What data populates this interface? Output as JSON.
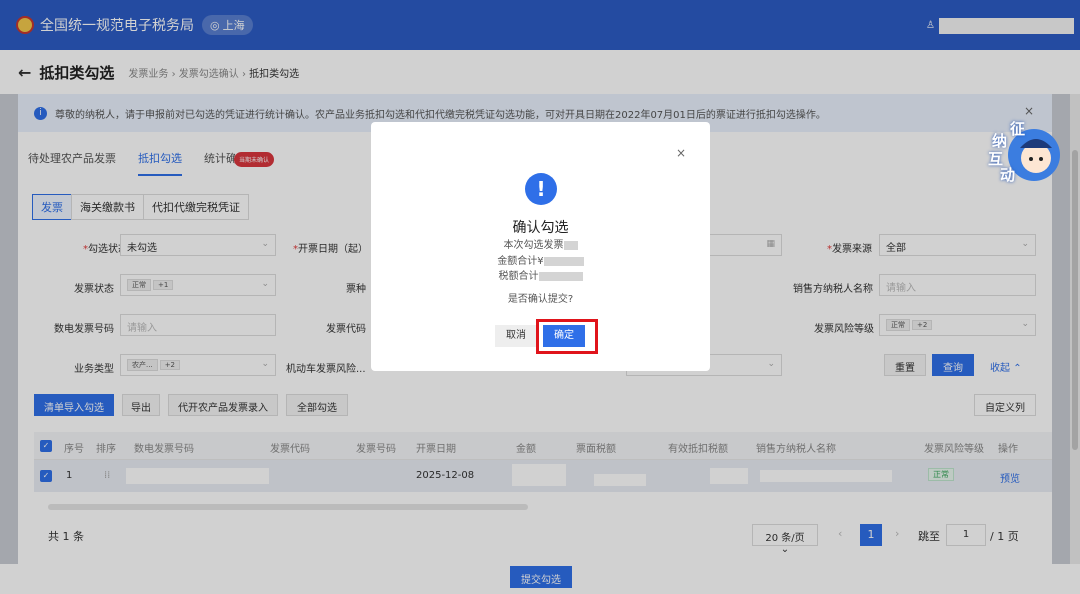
{
  "topbar": {
    "app_title": "全国统一规范电子税务局",
    "region": "上海",
    "region_icon": "location-pin-icon"
  },
  "subheader": {
    "title": "抵扣类勾选",
    "breadcrumb": [
      "发票业务",
      "发票勾选确认",
      "抵扣类勾选"
    ]
  },
  "notice": {
    "text": "尊敬的纳税人，请于申报前对已勾选的凭证进行统计确认。农产品业务抵扣勾选和代扣代缴完税凭证勾选功能，可对开具日期在2022年07月01日后的票证进行抵扣勾选操作。",
    "close": "×"
  },
  "tabs": [
    {
      "label": "待处理农产品发票"
    },
    {
      "label": "抵扣勾选"
    },
    {
      "label": "统计确认"
    }
  ],
  "tab_badge": "当期未确认",
  "subtabs": [
    {
      "label": "发票"
    },
    {
      "label": "海关缴款书"
    },
    {
      "label": "代扣代缴完税凭证"
    }
  ],
  "filters": {
    "select_status": {
      "label": "勾选状态",
      "value": "未勾选"
    },
    "issue_date_start": {
      "label": "开票日期（起）"
    },
    "invoice_source": {
      "label": "发票来源",
      "value": "全部"
    },
    "invoice_status": {
      "label": "发票状态",
      "chip": "正常",
      "more": "+1"
    },
    "ticket_type": {
      "label": "票种"
    },
    "seller_name": {
      "label": "销售方纳税人名称",
      "placeholder": "请输入"
    },
    "digital_no": {
      "label": "数电发票号码",
      "placeholder": "请输入"
    },
    "invoice_code": {
      "label": "发票代码"
    },
    "risk_level": {
      "label": "发票风险等级",
      "chip": "正常",
      "more": "+2"
    },
    "business_type": {
      "label": "业务类型",
      "chip": "农产...",
      "more": "+2"
    },
    "vehicle_risk": {
      "label": "机动车发票风险..."
    }
  },
  "actions": {
    "reset": "重置",
    "query": "查询",
    "collapse": "收起",
    "collapse_icon": "chevron-up-icon"
  },
  "toolbar": {
    "import_select": "清单导入勾选",
    "export": "导出",
    "agri_entry": "代开农产品发票录入",
    "select_all": "全部勾选",
    "custom_columns": "自定义列"
  },
  "table": {
    "headers": [
      "序号",
      "排序",
      "数电发票号码",
      "发票代码",
      "发票号码",
      "开票日期",
      "金额",
      "票面税额",
      "有效抵扣税额",
      "销售方纳税人名称",
      "发票风险等级",
      "操作"
    ],
    "rows": [
      {
        "index": "1",
        "date": "2025-12-08",
        "risk": "正常",
        "action": "预览"
      }
    ]
  },
  "pager": {
    "total": "共 1 条",
    "page_size": "20 条/页",
    "current": "1",
    "goto_label": "跳至",
    "goto_value": "1",
    "total_pages": "/ 1 页"
  },
  "submit": "提交勾选",
  "modal": {
    "icon": "info-alert-icon",
    "title": "确认勾选",
    "line1": "本次勾选发票",
    "line2": "金额合计¥",
    "line3": "税额合计",
    "question": "是否确认提交?",
    "cancel": "取消",
    "confirm": "确定",
    "close": "×"
  },
  "mascot": {
    "text": [
      "征",
      "纳",
      "互",
      "动"
    ]
  },
  "colors": {
    "primary": "#2f6fe8",
    "header": "#2c5cc5",
    "highlight": "#e0141b",
    "badge": "#d9363e"
  }
}
